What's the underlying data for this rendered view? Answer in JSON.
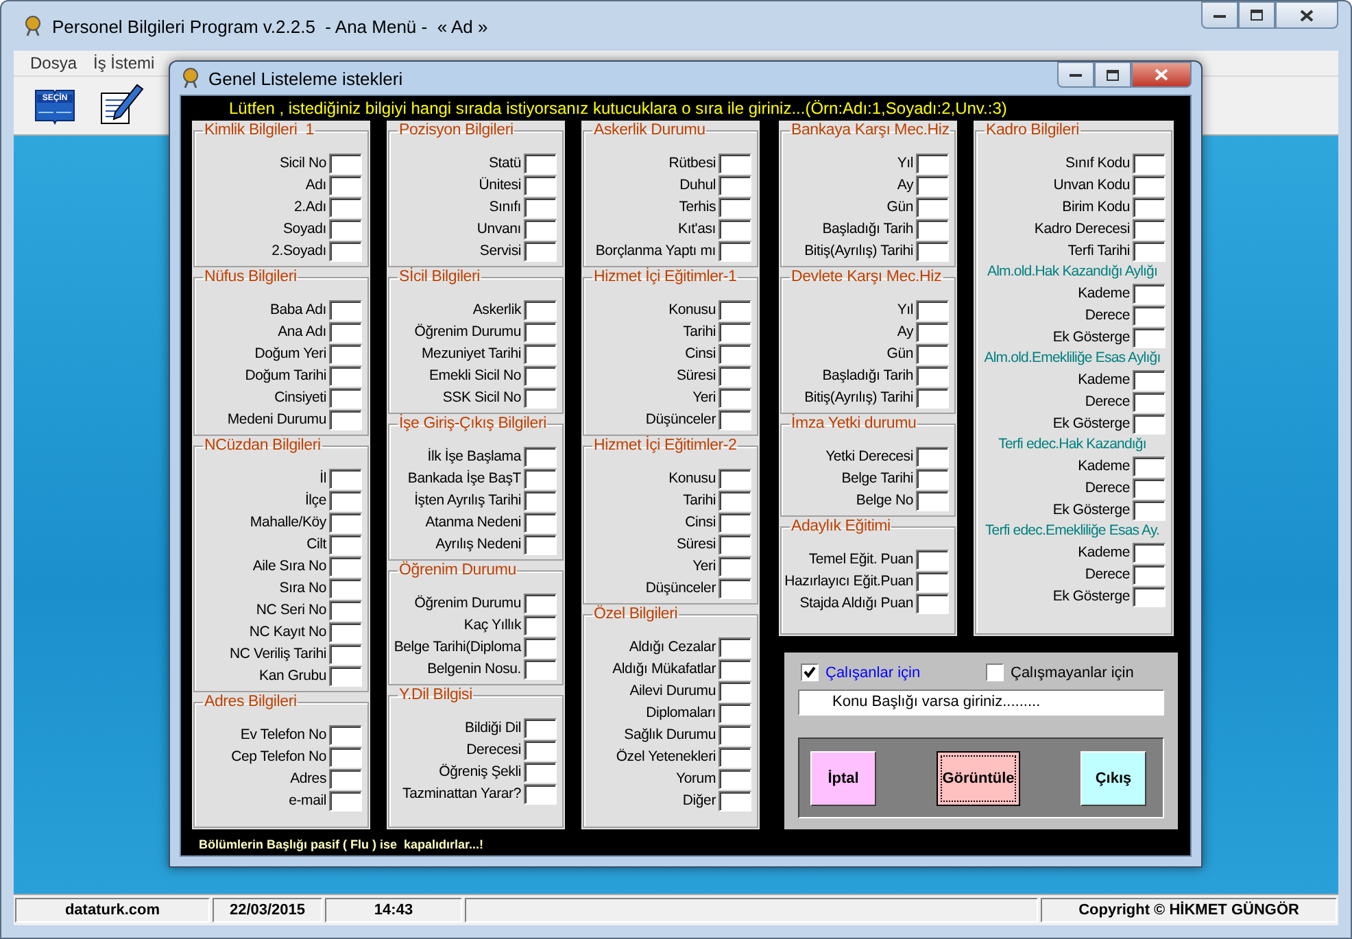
{
  "app": {
    "title": "Personel Bilgileri Program v.2.2.5  - Ana Menü -  « Ad »"
  },
  "menu": [
    "Dosya",
    "İş İstemi"
  ],
  "toolbar": {
    "select_label": "SEÇİN"
  },
  "dialog": {
    "title": "Genel Listeleme istekleri",
    "instruction": "Lütfen , istediğiniz bilgiyi hangi sırada istiyorsanız kutucuklara o sıra ile giriniz...(Örn:Adı:1,Soyadı:2,Unv.:3)",
    "columns": [
      {
        "groups": [
          {
            "title": "Kimlik Bilgileri  1",
            "items": [
              {
                "kind": "field",
                "label": "Sicil No"
              },
              {
                "kind": "field",
                "label": "Adı"
              },
              {
                "kind": "field",
                "label": "2.Adı"
              },
              {
                "kind": "field",
                "label": "Soyadı"
              },
              {
                "kind": "field",
                "label": "2.Soyadı"
              }
            ]
          },
          {
            "title": "Nüfus Bilgileri",
            "items": [
              {
                "kind": "field",
                "label": "Baba Adı"
              },
              {
                "kind": "field",
                "label": "Ana Adı"
              },
              {
                "kind": "field",
                "label": "Doğum Yeri"
              },
              {
                "kind": "field",
                "label": "Doğum Tarihi"
              },
              {
                "kind": "field",
                "label": "Cinsiyeti"
              },
              {
                "kind": "field",
                "label": "Medeni Durumu"
              }
            ]
          },
          {
            "title": "NCüzdan Bilgileri",
            "items": [
              {
                "kind": "field",
                "label": "İl"
              },
              {
                "kind": "field",
                "label": "İlçe"
              },
              {
                "kind": "field",
                "label": "Mahalle/Köy"
              },
              {
                "kind": "field",
                "label": "Cilt"
              },
              {
                "kind": "field",
                "label": "Aile Sıra No"
              },
              {
                "kind": "field",
                "label": "Sıra No"
              },
              {
                "kind": "field",
                "label": "NC Seri No"
              },
              {
                "kind": "field",
                "label": "NC Kayıt No"
              },
              {
                "kind": "field",
                "label": "NC Veriliş Tarihi"
              },
              {
                "kind": "field",
                "label": "Kan Grubu"
              }
            ]
          },
          {
            "title": "Adres Bilgileri",
            "items": [
              {
                "kind": "field",
                "label": "Ev Telefon No"
              },
              {
                "kind": "field",
                "label": "Cep Telefon No"
              },
              {
                "kind": "field",
                "label": "Adres"
              },
              {
                "kind": "field",
                "label": "e-mail"
              }
            ]
          }
        ]
      },
      {
        "groups": [
          {
            "title": "Pozisyon Bilgileri",
            "items": [
              {
                "kind": "field",
                "label": "Statü"
              },
              {
                "kind": "field",
                "label": "Ünitesi"
              },
              {
                "kind": "field",
                "label": "Sınıfı"
              },
              {
                "kind": "field",
                "label": "Unvanı"
              },
              {
                "kind": "field",
                "label": "Servisi"
              }
            ]
          },
          {
            "title": "Sİcil Bilgileri",
            "items": [
              {
                "kind": "field",
                "label": "Askerlik"
              },
              {
                "kind": "field",
                "label": "Öğrenim Durumu"
              },
              {
                "kind": "field",
                "label": "Mezuniyet Tarihi"
              },
              {
                "kind": "field",
                "label": "Emekli Sicil No"
              },
              {
                "kind": "field",
                "label": "SSK Sicil No"
              }
            ]
          },
          {
            "title": "İşe Giriş-Çıkış Bilgileri",
            "items": [
              {
                "kind": "field",
                "label": "İlk İşe Başlama"
              },
              {
                "kind": "field",
                "label": "Bankada İşe BaşT"
              },
              {
                "kind": "field",
                "label": "İşten Ayrılış Tarihi"
              },
              {
                "kind": "field",
                "label": "Atanma Nedeni"
              },
              {
                "kind": "field",
                "label": "Ayrılış Nedeni"
              }
            ]
          },
          {
            "title": "Öğrenim Durumu",
            "items": [
              {
                "kind": "field",
                "label": "Öğrenim Durumu"
              },
              {
                "kind": "field",
                "label": "Kaç Yıllık"
              },
              {
                "kind": "field",
                "label": "Belge Tarihi(Diploma"
              },
              {
                "kind": "field",
                "label": "Belgenin Nosu."
              }
            ]
          },
          {
            "title": "Y.Dil Bilgisi",
            "items": [
              {
                "kind": "field",
                "label": "Bildiği Dil"
              },
              {
                "kind": "field",
                "label": "Derecesi"
              },
              {
                "kind": "field",
                "label": "Öğreniş Şekli"
              },
              {
                "kind": "field",
                "label": "Tazminattan Yarar?"
              }
            ]
          }
        ]
      },
      {
        "groups": [
          {
            "title": "Askerlik Durumu",
            "items": [
              {
                "kind": "field",
                "label": "Rütbesi"
              },
              {
                "kind": "field",
                "label": "Duhul"
              },
              {
                "kind": "field",
                "label": "Terhis"
              },
              {
                "kind": "field",
                "label": "Kıt'ası"
              },
              {
                "kind": "field",
                "label": "Borçlanma Yaptı mı"
              }
            ]
          },
          {
            "title": "Hizmet İçi Eğitimler-1",
            "items": [
              {
                "kind": "field",
                "label": "Konusu"
              },
              {
                "kind": "field",
                "label": "Tarihi"
              },
              {
                "kind": "field",
                "label": "Cinsi"
              },
              {
                "kind": "field",
                "label": "Süresi"
              },
              {
                "kind": "field",
                "label": "Yeri"
              },
              {
                "kind": "field",
                "label": "Düşünceler"
              }
            ]
          },
          {
            "title": "Hizmet İçi Eğitimler-2",
            "items": [
              {
                "kind": "field",
                "label": "Konusu"
              },
              {
                "kind": "field",
                "label": "Tarihi"
              },
              {
                "kind": "field",
                "label": "Cinsi"
              },
              {
                "kind": "field",
                "label": "Süresi"
              },
              {
                "kind": "field",
                "label": "Yeri"
              },
              {
                "kind": "field",
                "label": "Düşünceler"
              }
            ]
          },
          {
            "title": "Özel Bilgileri",
            "items": [
              {
                "kind": "field",
                "label": "Aldığı Cezalar"
              },
              {
                "kind": "field",
                "label": "Aldığı Mükafatlar"
              },
              {
                "kind": "field",
                "label": "Ailevi Durumu"
              },
              {
                "kind": "field",
                "label": "Diplomaları"
              },
              {
                "kind": "field",
                "label": "Sağlık Durumu"
              },
              {
                "kind": "field",
                "label": "Özel Yetenekleri"
              },
              {
                "kind": "field",
                "label": "Yorum"
              },
              {
                "kind": "field",
                "label": "Diğer"
              }
            ]
          }
        ]
      },
      {
        "groups": [
          {
            "title": "Bankaya Karşı Mec.Hiz",
            "items": [
              {
                "kind": "field",
                "label": "Yıl"
              },
              {
                "kind": "field",
                "label": "Ay"
              },
              {
                "kind": "field",
                "label": "Gün"
              },
              {
                "kind": "field",
                "label": "Başladığı Tarih"
              },
              {
                "kind": "field",
                "label": "Bitiş(Ayrılış) Tarihi"
              }
            ]
          },
          {
            "title": "Devlete Karşı Mec.Hiz",
            "items": [
              {
                "kind": "field",
                "label": "Yıl"
              },
              {
                "kind": "field",
                "label": "Ay"
              },
              {
                "kind": "field",
                "label": "Gün"
              },
              {
                "kind": "field",
                "label": "Başladığı Tarih"
              },
              {
                "kind": "field",
                "label": "Bitiş(Ayrılış) Tarihi"
              }
            ]
          },
          {
            "title": "İmza Yetki durumu",
            "items": [
              {
                "kind": "field",
                "label": "Yetki Derecesi"
              },
              {
                "kind": "field",
                "label": "Belge Tarihi"
              },
              {
                "kind": "field",
                "label": "Belge No"
              }
            ]
          },
          {
            "title": "Adaylık Eğitimi",
            "items": [
              {
                "kind": "field",
                "label": "Temel Eğit. Puan"
              },
              {
                "kind": "field",
                "label": "Hazırlayıcı Eğit.Puan"
              },
              {
                "kind": "field",
                "label": "Stajda Aldığı Puan"
              }
            ]
          }
        ]
      },
      {
        "groups": [
          {
            "title": "Kadro Bilgileri",
            "items": [
              {
                "kind": "field",
                "label": "Sınıf Kodu"
              },
              {
                "kind": "field",
                "label": "Unvan Kodu"
              },
              {
                "kind": "field",
                "label": "Birim Kodu"
              },
              {
                "kind": "field",
                "label": "Kadro Derecesi"
              },
              {
                "kind": "field",
                "label": "Terfi Tarihi"
              },
              {
                "kind": "subheading",
                "label": "Alm.old.Hak Kazandığı Aylığı"
              },
              {
                "kind": "field",
                "label": "Kademe"
              },
              {
                "kind": "field",
                "label": "Derece"
              },
              {
                "kind": "field",
                "label": "Ek Gösterge"
              },
              {
                "kind": "subheading",
                "label": "Alm.old.Emekliliğe Esas Aylığı"
              },
              {
                "kind": "field",
                "label": "Kademe"
              },
              {
                "kind": "field",
                "label": "Derece"
              },
              {
                "kind": "field",
                "label": "Ek Gösterge"
              },
              {
                "kind": "subheading",
                "label": "Terfi edec.Hak Kazandığı"
              },
              {
                "kind": "field",
                "label": "Kademe"
              },
              {
                "kind": "field",
                "label": "Derece"
              },
              {
                "kind": "field",
                "label": "Ek Gösterge"
              },
              {
                "kind": "subheading",
                "label": "Terfi edec.Emekliliğe Esas Ay."
              },
              {
                "kind": "field",
                "label": "Kademe"
              },
              {
                "kind": "field",
                "label": "Derece"
              },
              {
                "kind": "field",
                "label": "Ek Gösterge"
              }
            ]
          }
        ]
      }
    ],
    "options": [
      {
        "label": "Çalışanlar için",
        "checked": true
      },
      {
        "label": "Çalışmayanlar için",
        "checked": false
      }
    ],
    "subject_field": {
      "value": "Konu Başlığı varsa giriniz........."
    },
    "buttons": [
      {
        "label": "İptal",
        "color": "#ffc0ff",
        "focused": false
      },
      {
        "label": "Görüntüle",
        "color": "#ffc0c0",
        "focused": true
      },
      {
        "label": "Çıkış",
        "color": "#c0ffff",
        "focused": false
      }
    ],
    "note": "Bölümlerin Başlığı pasif ( Flu ) ise  kapalıdırlar...!"
  },
  "status_bar": [
    "dataturk.com",
    "22/03/2015",
    "14:43",
    "Copyright © HİKMET GÜNGÖR"
  ]
}
